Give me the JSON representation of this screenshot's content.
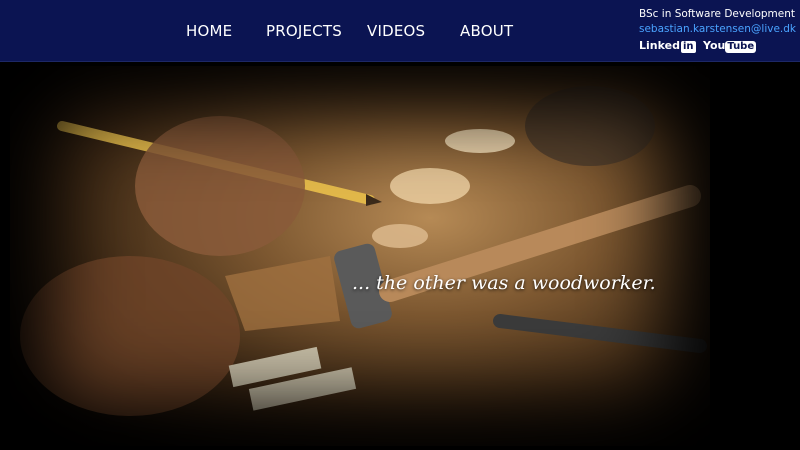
{
  "nav": {
    "items": [
      {
        "label": "HOME"
      },
      {
        "label": "PROJECTS"
      },
      {
        "label": "VIDEOS"
      },
      {
        "label": "ABOUT"
      }
    ]
  },
  "contact": {
    "degree": "BSc in Software Development",
    "email": "sebastian.karstensen@live.dk",
    "linkedin_label": "Linked",
    "linkedin_badge": "in",
    "youtube_prefix": "You",
    "youtube_badge": "Tube"
  },
  "hero": {
    "tagline": "... the other was a woodworker."
  },
  "colors": {
    "header_bg": "#0b1452",
    "email_link": "#4aa3ff",
    "page_bg": "#000000"
  }
}
